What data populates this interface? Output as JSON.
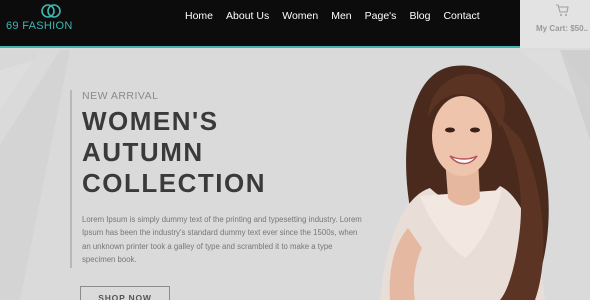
{
  "brand": {
    "name": "69 FASHION"
  },
  "nav": {
    "items": [
      {
        "label": "Home"
      },
      {
        "label": "About Us"
      },
      {
        "label": "Women"
      },
      {
        "label": "Men"
      },
      {
        "label": "Page's"
      },
      {
        "label": "Blog"
      },
      {
        "label": "Contact"
      }
    ]
  },
  "cart": {
    "label": "My Cart: $50.."
  },
  "hero": {
    "eyebrow": "NEW ARRIVAL",
    "headline_lines": [
      "WOMEN'S",
      "AUTUMN",
      "COLLECTION"
    ],
    "description": "Lorem Ipsum is simply dummy text of the printing and typesetting industry. Lorem Ipsum has been the industry's standard dummy text ever since the 1500s, when an unknown printer took a galley of type and scrambled it to make a type specimen book.",
    "button_label": "SHOP NOW"
  },
  "colors": {
    "accent": "#3fb6b0",
    "nav_bg": "#0c0c0c",
    "hero_bg": "#d9d9d9",
    "headline": "#3a3a3a"
  }
}
